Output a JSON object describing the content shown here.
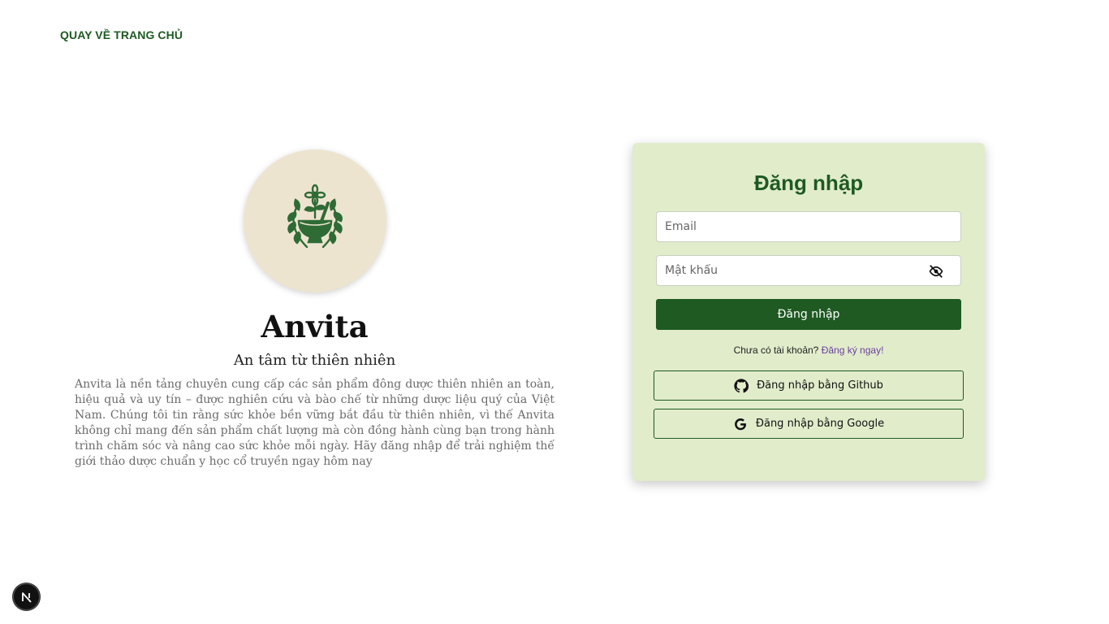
{
  "nav": {
    "back_label": "QUAY VỀ TRANG CHỦ"
  },
  "brand": {
    "logo_icon": "herbal-mortar-logo",
    "name": "Anvita",
    "tagline": "An tâm từ thiên nhiên",
    "description": "Anvita là nền tảng chuyên cung cấp các sản phẩm đông dược thiên nhiên an toàn, hiệu quả và uy tín – được nghiên cứu và bào chế từ những dược liệu quý của Việt Nam. Chúng tôi tin rằng sức khỏe bền vững bắt đầu từ thiên nhiên, vì thế Anvita không chỉ mang đến sản phẩm chất lượng mà còn đồng hành cùng bạn trong hành trình chăm sóc và nâng cao sức khỏe mỗi ngày. Hãy đăng nhập để trải nghiệm thế giới thảo dược chuẩn y học cổ truyền ngay hôm nay"
  },
  "login": {
    "title": "Đăng nhập",
    "email_placeholder": "Email",
    "email_value": "",
    "password_placeholder": "Mật khẩu",
    "password_value": "",
    "password_toggle_icon": "eye-off-icon",
    "submit_label": "Đăng nhập",
    "signup_prompt": "Chưa có tài khoản?",
    "signup_link": "Đăng ký ngay!",
    "github_label": "Đăng nhập bằng Github",
    "github_icon": "github-icon",
    "google_label": "Đăng nhập bằng Google",
    "google_icon": "google-icon"
  },
  "dev_badge": {
    "label": "N"
  },
  "colors": {
    "primary_green": "#1e5a22",
    "card_bg": "#e1eccb",
    "logo_bg": "#ede4d0",
    "link_purple": "#6a3fa0"
  }
}
